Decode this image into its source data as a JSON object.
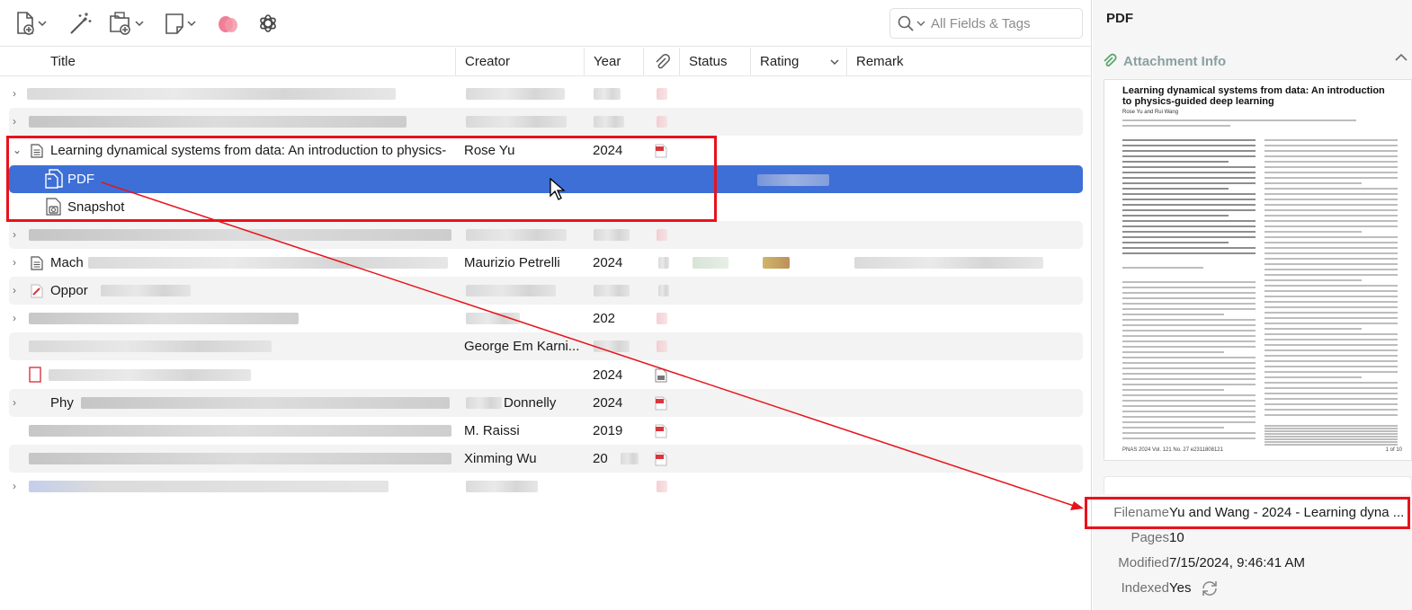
{
  "toolbar": {
    "search_placeholder": "All Fields & Tags"
  },
  "columns": {
    "title": "Title",
    "creator": "Creator",
    "year": "Year",
    "status": "Status",
    "rating": "Rating",
    "remark": "Remark"
  },
  "rows": {
    "learning": {
      "title": "Learning dynamical systems from data: An introduction to physics-",
      "creator": "Rose Yu",
      "year": "2024"
    },
    "pdf": {
      "title": "PDF"
    },
    "snapshot": {
      "title": "Snapshot"
    },
    "r5": {
      "title_fragment": "Mach",
      "creator": "Maurizio Petrelli",
      "year": "2024"
    },
    "r6": {
      "title_fragment": "Oppor"
    },
    "r7": {
      "year": "202"
    },
    "r8": {
      "creator": "George Em Karni..."
    },
    "r9": {
      "year": "2024"
    },
    "r10": {
      "title_fragment": "Phy",
      "creator": "Donnelly",
      "year": "2024"
    },
    "r11": {
      "creator": "M. Raissi",
      "year": "2019"
    },
    "r12": {
      "creator": "Xinming Wu",
      "year": "20"
    }
  },
  "right_pane": {
    "title": "PDF",
    "section": "Attachment Info",
    "paper_title": "Learning dynamical systems from data: An introduction to physics-guided deep learning",
    "paper_authors": "Rose Yu and Rui Wang",
    "paper_footer": "PNAS  2024  Vol. 121  No. 27  e2311808121",
    "paper_page": "1 of 10",
    "filename_label": "Filename",
    "filename_value": "Yu and Wang - 2024 - Learning dyna ...",
    "pages_label": "Pages",
    "pages_value": "10",
    "modified_label": "Modified",
    "modified_value": "7/15/2024, 9:46:41 AM",
    "indexed_label": "Indexed",
    "indexed_value": "Yes"
  },
  "colors": {
    "selection": "#3d6fd6",
    "annotation_red": "#e8121b",
    "pdf_icon": "#d9363e"
  }
}
